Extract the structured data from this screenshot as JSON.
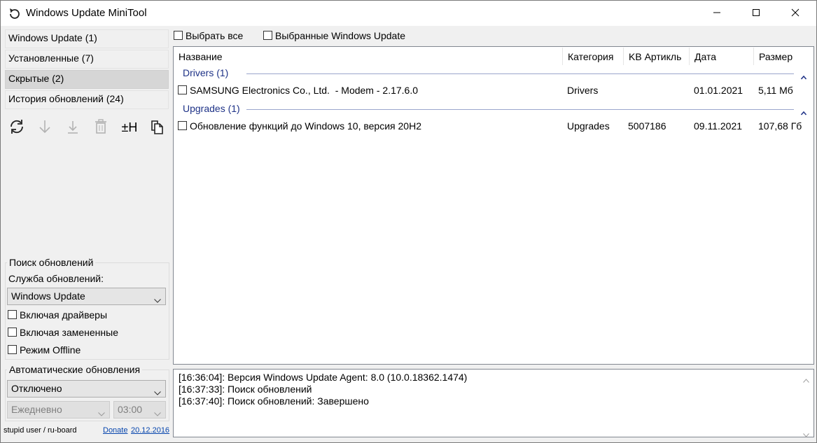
{
  "window": {
    "title": "Windows Update MiniTool",
    "icons": {
      "app": "refresh-icon",
      "minimize": "minimize-icon",
      "maximize": "maximize-icon",
      "close": "close-icon"
    }
  },
  "sidebar": {
    "nav": [
      {
        "label": "Windows Update (1)",
        "selected": false
      },
      {
        "label": "Установленные (7)",
        "selected": false
      },
      {
        "label": "Скрытые (2)",
        "selected": true
      },
      {
        "label": "История обновлений (24)",
        "selected": false
      }
    ],
    "toolbar": [
      {
        "icon": "refresh-icon",
        "enabled": true
      },
      {
        "icon": "download-icon",
        "enabled": false
      },
      {
        "icon": "install-icon",
        "enabled": false
      },
      {
        "icon": "trash-icon",
        "enabled": false
      },
      {
        "icon": "hide-icon",
        "label": "±H",
        "enabled": true
      },
      {
        "icon": "copy-icon",
        "enabled": true
      }
    ],
    "search": {
      "title": "Поиск обновлений",
      "service_label": "Служба обновлений:",
      "service_value": "Windows Update",
      "options": [
        {
          "label": "Включая драйверы",
          "checked": false
        },
        {
          "label": "Включая замененные",
          "checked": false
        },
        {
          "label": "Режим Offline",
          "checked": false
        }
      ]
    },
    "auto": {
      "title": "Автоматические обновления",
      "mode": "Отключено",
      "schedule": "Ежедневно",
      "time": "03:00"
    },
    "footer": {
      "author": "stupid user / ru-board",
      "donate": "Donate",
      "date": "20.12.2016"
    }
  },
  "top": {
    "select_all": "Выбрать все",
    "selected_updates": "Выбранные Windows Update"
  },
  "list": {
    "columns": [
      "Название",
      "Категория",
      "KB Артикль",
      "Дата",
      "Размер"
    ],
    "groups": [
      {
        "title": "Drivers (1)",
        "rows": [
          {
            "name": "SAMSUNG Electronics Co., Ltd.  - Modem - 2.17.6.0",
            "category": "Drivers",
            "kb": "",
            "date": "01.01.2021",
            "size": "5,11 Мб"
          }
        ]
      },
      {
        "title": "Upgrades (1)",
        "rows": [
          {
            "name": "Обновление функций до Windows 10, версия 20H2",
            "category": "Upgrades",
            "kb": "5007186",
            "date": "09.11.2021",
            "size": "107,68 Гб"
          }
        ]
      }
    ]
  },
  "log": [
    "[16:36:04]: Версия Windows Update Agent: 8.0 (10.0.18362.1474)",
    "[16:37:33]: Поиск обновлений",
    "[16:37:40]: Поиск обновлений: Завершено"
  ],
  "colors": {
    "group_header": "#1e3287",
    "link": "#0645ad",
    "selected_nav": "#d6d6d6"
  }
}
